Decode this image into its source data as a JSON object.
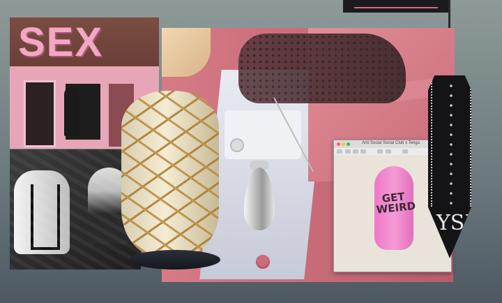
{
  "storefront": {
    "sign_text": "SEX"
  },
  "browser": {
    "window_title": "Anti Social Social Club x Tenga",
    "traffic_lights": [
      "#ff5f57",
      "#febc2e",
      "#28c840"
    ],
    "toy_text": "GET WEIRD",
    "toy_color": "#f08ad0"
  },
  "paddle": {
    "logo_text": "YSL"
  },
  "colors": {
    "background": "#6f7c7f",
    "suit_pink": "#cc6f7c",
    "rope_gold": "#b78a3e"
  },
  "icons": [
    "glove-icon",
    "pendant-icon",
    "cufflink-icon"
  ]
}
